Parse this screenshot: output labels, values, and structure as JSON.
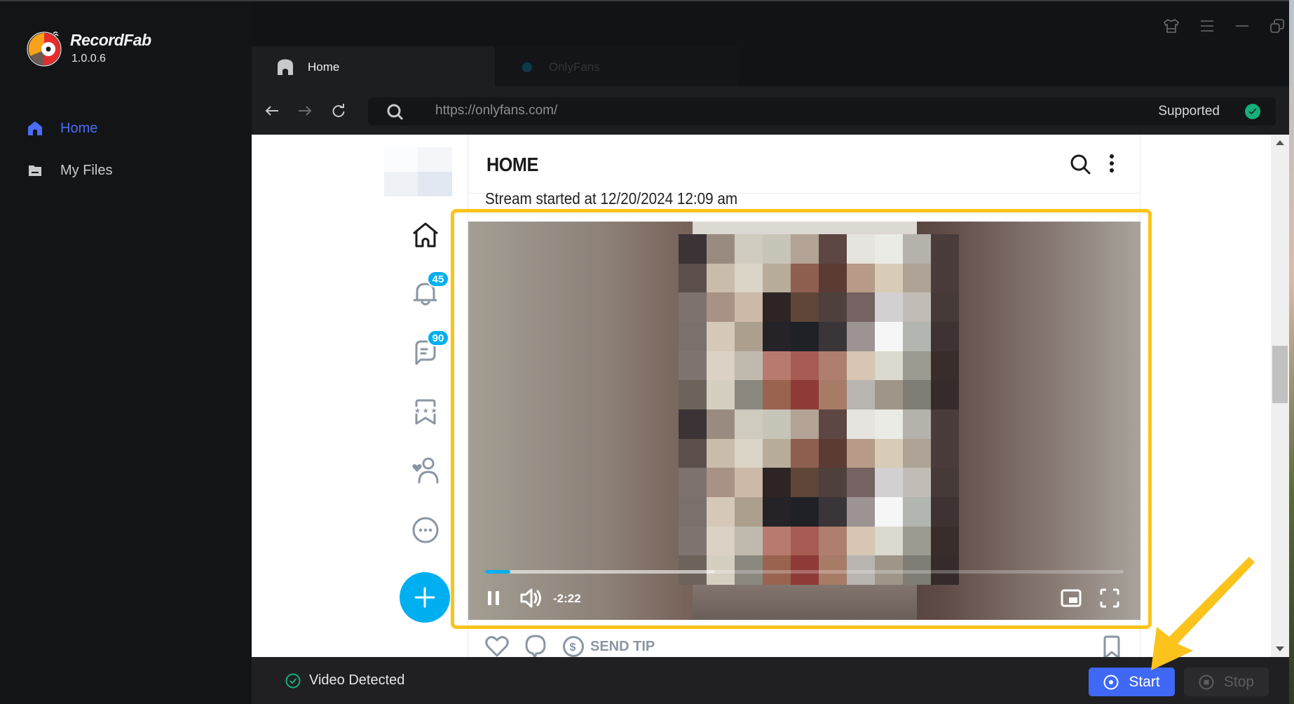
{
  "app": {
    "name": "RecordFab",
    "version": "1.0.0.6",
    "brand_colors": {
      "accent": "#4a6cf7",
      "start_button": "#3f68f4",
      "supported_green": "#14b07a"
    }
  },
  "sidebar": {
    "items": [
      {
        "label": "Home",
        "icon": "home-icon",
        "active": true
      },
      {
        "label": "My Files",
        "icon": "folder-icon",
        "active": false
      }
    ]
  },
  "window_controls": [
    "skin-icon",
    "menu-icon",
    "minimize-icon",
    "restore-icon"
  ],
  "tabs": [
    {
      "label": "Home",
      "icon": "home-icon",
      "active": true
    },
    {
      "label": "OnlyFans",
      "icon": "site-favicon",
      "active": false
    }
  ],
  "address_bar": {
    "url": "https://onlyfans.com/",
    "status": "Supported"
  },
  "webpage": {
    "header_title": "HOME",
    "left_nav": [
      {
        "icon": "home-icon"
      },
      {
        "icon": "bell-icon",
        "badge": "45"
      },
      {
        "icon": "chat-icon",
        "badge": "90"
      },
      {
        "icon": "bookmark-stars-icon"
      },
      {
        "icon": "user-heart-icon"
      },
      {
        "icon": "more-circle-icon"
      }
    ],
    "stream_started": "Stream started at 12/20/2024 12:09 am",
    "video": {
      "time_remaining": "-2:22",
      "played_fraction": 0.04,
      "buffered_fraction": 0.36,
      "state": "playing"
    },
    "post_actions": {
      "send_tip": "SEND TIP"
    },
    "scroll_position_fraction": 0.45
  },
  "bottom_bar": {
    "status": "Video Detected",
    "start_label": "Start",
    "stop_label": "Stop"
  }
}
